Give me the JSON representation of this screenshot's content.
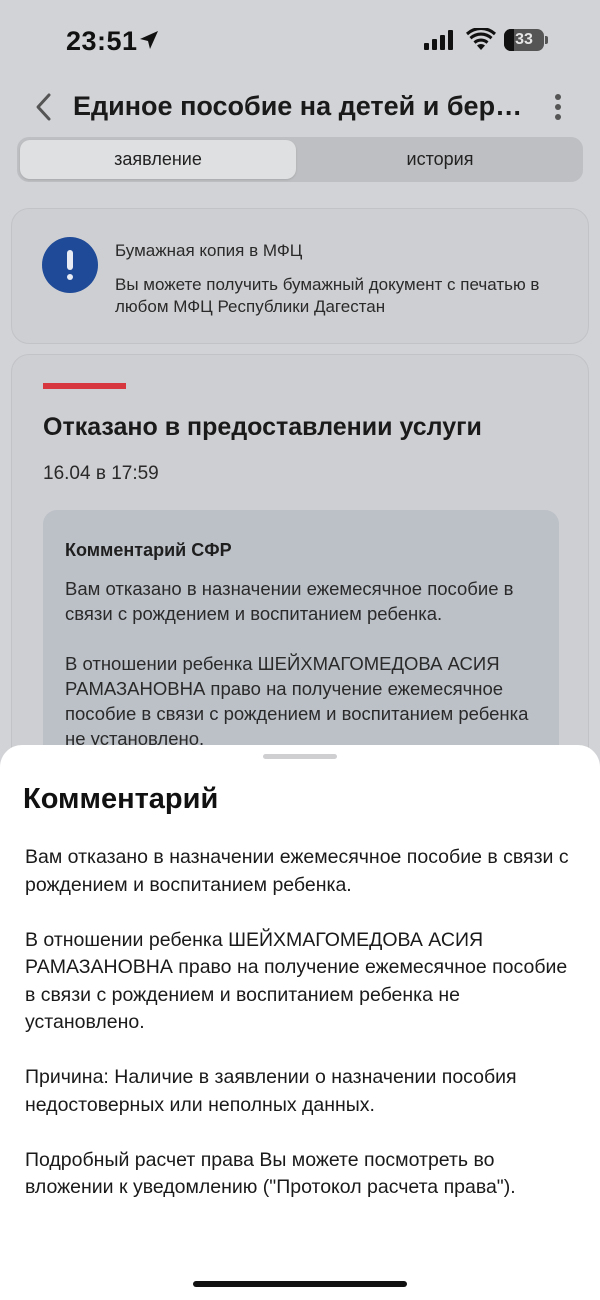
{
  "status_bar": {
    "time": "23:51",
    "battery": "33",
    "icons": [
      "location-arrow-icon",
      "signal-icon",
      "wifi-icon",
      "battery-icon"
    ]
  },
  "header": {
    "title": "Единое пособие на детей и беременных",
    "icons": [
      "chevron-left-icon",
      "more-vertical-icon"
    ]
  },
  "tabs": [
    {
      "label": "заявление",
      "active": true
    },
    {
      "label": "история",
      "active": false
    }
  ],
  "info_card": {
    "icon": "exclamation-icon",
    "title": "Бумажная копия в МФЦ",
    "text": "Вы можете получить бумажный документ с печатью в любом МФЦ Республики Дагестан"
  },
  "status_card": {
    "title": "Отказано в предоставлении услуги",
    "date": "16.04 в 17:59",
    "comment_title": "Комментарий СФР",
    "comment_paragraphs": [
      "Вам отказано в назначении ежемесячное пособие в связи с рождением и воспитанием ребенка.",
      "В отношении ребенка ШЕЙХМАГОМЕДОВА АСИЯ РАМАЗАНОВНА право на получение ежемесячное пособие в связи с рождением и воспитанием ребенка не установлено."
    ]
  },
  "sheet": {
    "title": "Комментарий",
    "paragraphs": [
      "Вам отказано в назначении ежемесячное пособие в связи с рождением и воспитанием ребенка.",
      "В отношении ребенка ШЕЙХМАГОМЕДОВА АСИЯ РАМАЗАНОВНА право на получение ежемесячное пособие в связи с рождением и воспитанием ребенка не установлено.",
      "Причина: Наличие в заявлении о назначении пособия недостоверных или неполных данных.",
      "Подробный расчет права Вы можете посмотреть во вложении к уведомлению (\"Протокол расчета права\")."
    ]
  },
  "colors": {
    "accent_blue": "#1e4a97",
    "status_red": "#d7383f"
  }
}
